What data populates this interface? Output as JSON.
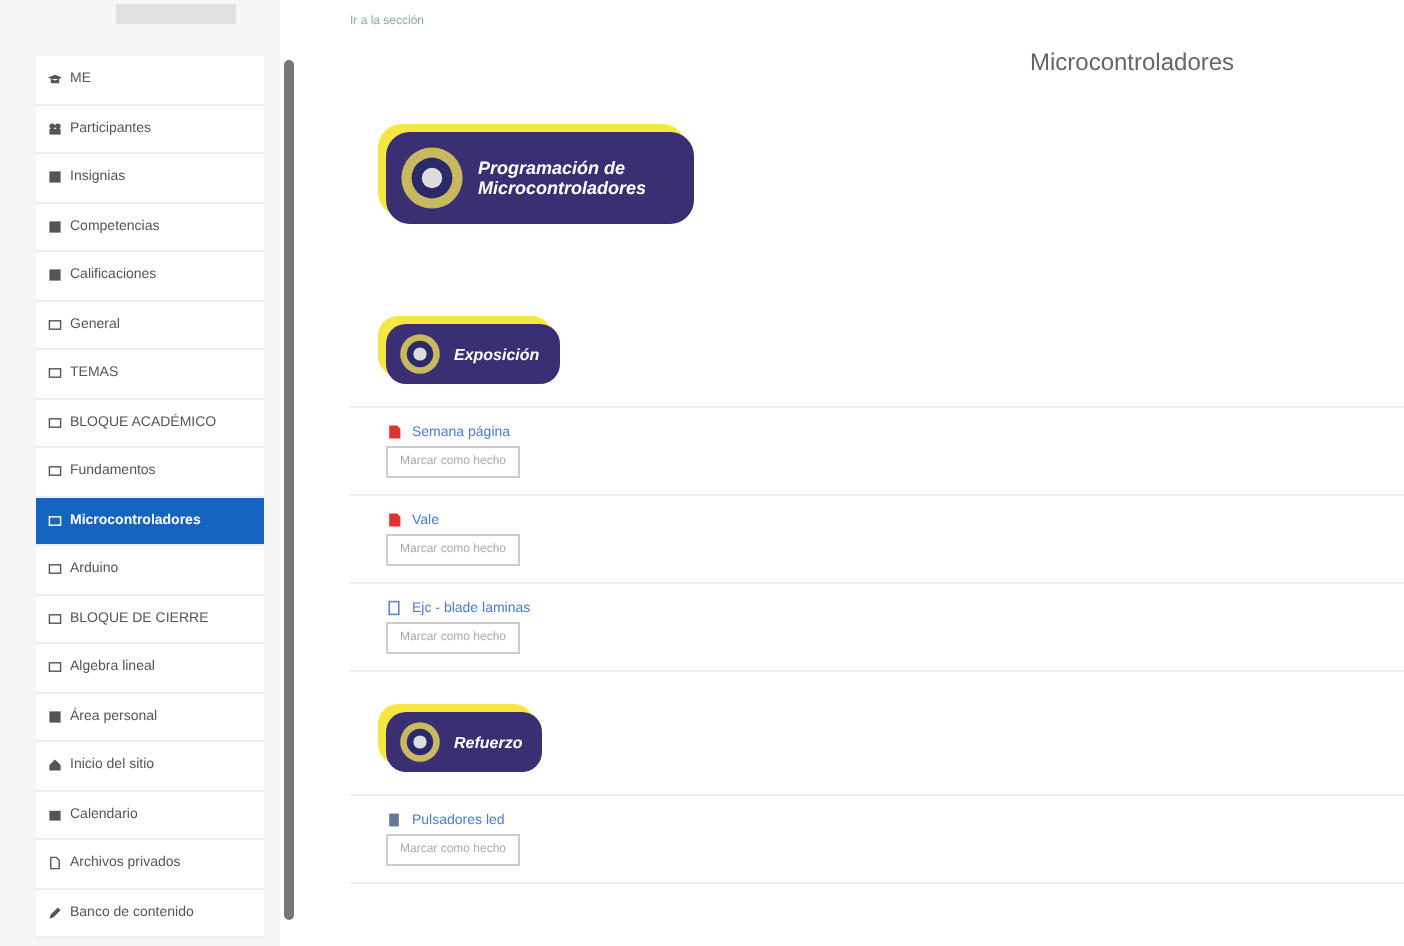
{
  "breadcrumb": "Ir a la sección",
  "sidebar": {
    "items": [
      {
        "label": "ME",
        "kind": "link",
        "selected": false
      },
      {
        "label": "Participantes",
        "kind": "link",
        "selected": false
      },
      {
        "label": "Insignias",
        "kind": "link",
        "selected": false
      },
      {
        "label": "Competencias",
        "kind": "link",
        "selected": false
      },
      {
        "label": "Calificaciones",
        "kind": "link",
        "selected": false
      },
      {
        "label": "General",
        "kind": "section",
        "selected": false
      },
      {
        "label": "TEMAS",
        "kind": "section",
        "selected": false
      },
      {
        "label": "BLOQUE ACADÉMICO",
        "kind": "section",
        "selected": false
      },
      {
        "label": "Fundamentos",
        "kind": "section",
        "selected": false
      },
      {
        "label": "Microcontroladores",
        "kind": "section",
        "selected": true
      },
      {
        "label": "Arduino",
        "kind": "section",
        "selected": false
      },
      {
        "label": "BLOQUE DE CIERRE",
        "kind": "section",
        "selected": false
      },
      {
        "label": "Algebra lineal",
        "kind": "section",
        "selected": false
      },
      {
        "label": "Área personal",
        "kind": "link",
        "selected": false
      },
      {
        "label": "Inicio del sitio",
        "kind": "link",
        "selected": false
      },
      {
        "label": "Calendario",
        "kind": "link",
        "selected": false
      },
      {
        "label": "Archivos privados",
        "kind": "link",
        "selected": false
      },
      {
        "label": "Banco de contenido",
        "kind": "link",
        "selected": false
      }
    ]
  },
  "section_title": "Microcontroladores",
  "blocks": [
    {
      "kind": "banner",
      "text": "Programación de Microcontroladores"
    },
    {
      "kind": "banner",
      "text": "Exposición"
    },
    {
      "kind": "activity",
      "title": "Semana página",
      "button": "Marcar como hecho"
    },
    {
      "kind": "activity",
      "title": "Vale",
      "button": "Marcar como hecho"
    },
    {
      "kind": "activity",
      "title": "Ejc - blade laminas",
      "button": "Marcar como hecho"
    },
    {
      "kind": "banner",
      "text": "Refuerzo"
    },
    {
      "kind": "activity",
      "title": "Pulsadores led",
      "button": "Marcar como hecho"
    }
  ]
}
